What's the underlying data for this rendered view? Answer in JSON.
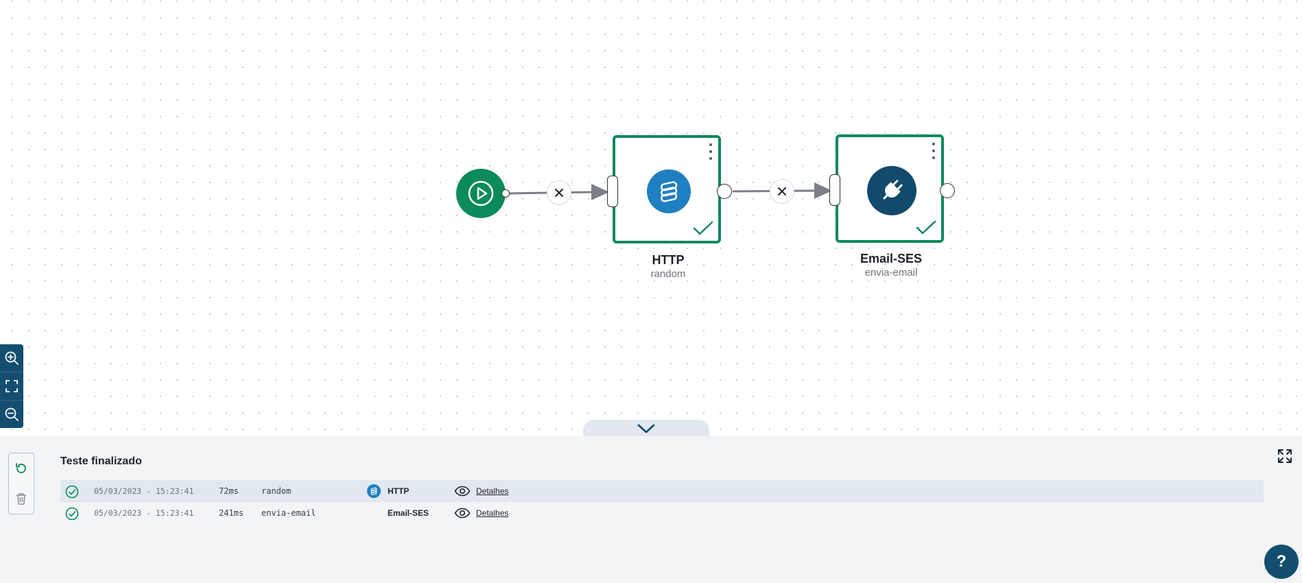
{
  "flow": {
    "nodes": [
      {
        "title": "HTTP",
        "subtitle": "random",
        "icon": "stack-icon",
        "icon_color": "#1f7fc0",
        "status": "success"
      },
      {
        "title": "Email-SES",
        "subtitle": "envia-email",
        "icon": "plug-icon",
        "icon_color": "#124a6b",
        "status": "success"
      }
    ]
  },
  "zoom_controls": [
    "zoom-in-icon",
    "fit-view-icon",
    "zoom-out-icon"
  ],
  "panel": {
    "title": "Teste finalizado",
    "logs": [
      {
        "timestamp": "05/03/2023 - 15:23:41",
        "duration": "72ms",
        "name": "random",
        "service": "HTTP",
        "details_label": "Detalhes"
      },
      {
        "timestamp": "05/03/2023 - 15:23:41",
        "duration": "241ms",
        "name": "envia-email",
        "service": "Email-SES",
        "details_label": "Detalhes"
      }
    ]
  },
  "help_label": "?",
  "colors": {
    "accent_green": "#0b8a5a",
    "brand_dark": "#134e6f",
    "http_blue": "#1f7fc0",
    "panel_bg": "#f2f4f6"
  }
}
